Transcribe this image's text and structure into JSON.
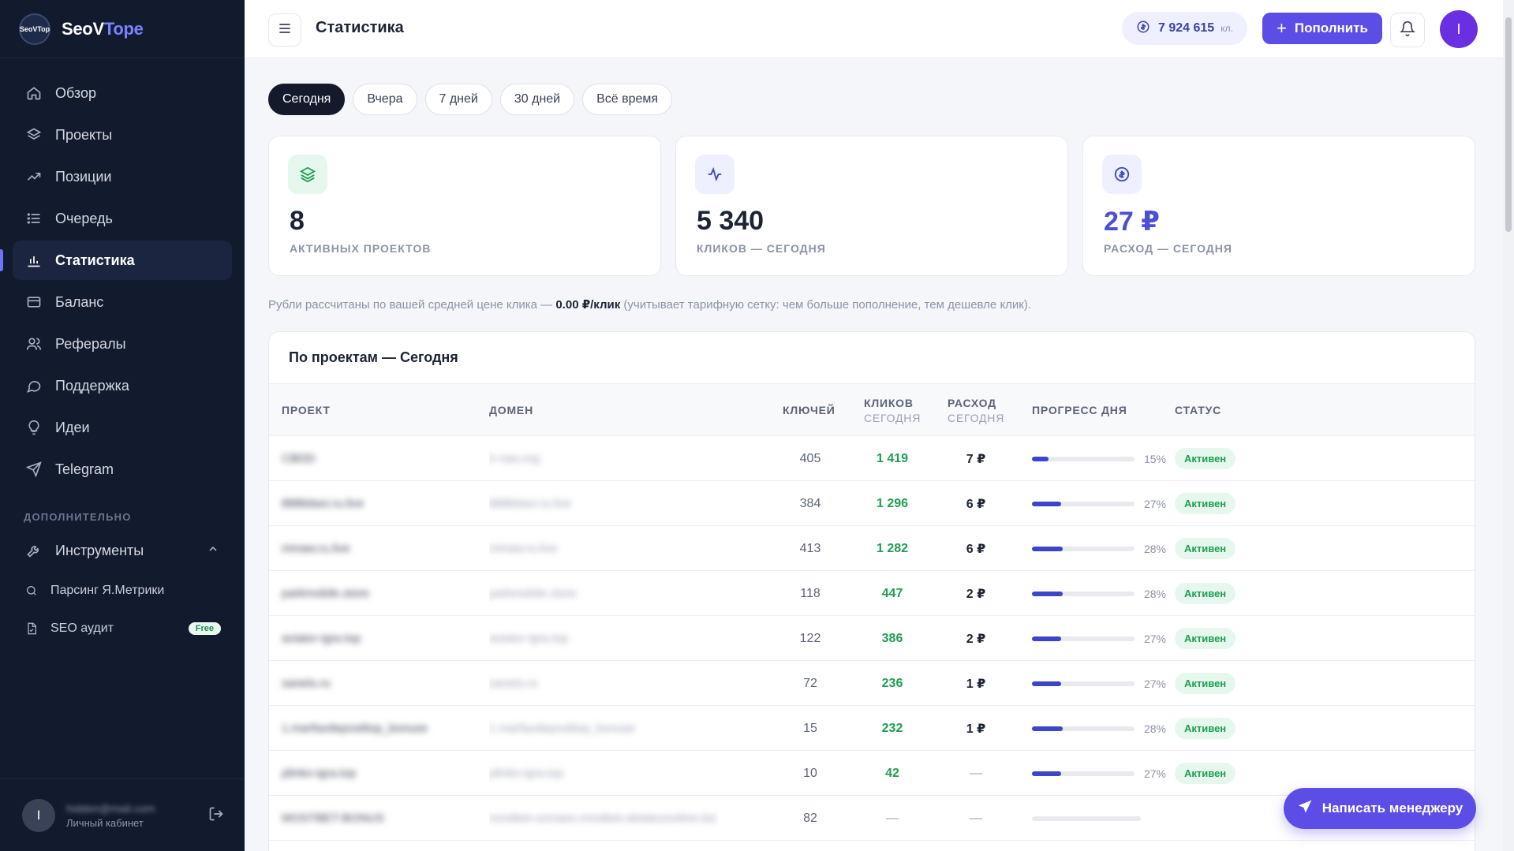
{
  "brand": {
    "logo_text": "SeoVTop",
    "name_main": "SeoV",
    "name_accent": "Tope"
  },
  "sidebar": {
    "items": [
      {
        "label": "Обзор",
        "icon": "home-icon"
      },
      {
        "label": "Проекты",
        "icon": "layers-icon"
      },
      {
        "label": "Позиции",
        "icon": "trend-icon"
      },
      {
        "label": "Очередь",
        "icon": "list-icon"
      },
      {
        "label": "Статистика",
        "icon": "bar-chart-icon",
        "active": true
      },
      {
        "label": "Баланс",
        "icon": "wallet-icon"
      },
      {
        "label": "Рефералы",
        "icon": "users-icon"
      },
      {
        "label": "Поддержка",
        "icon": "chat-icon"
      },
      {
        "label": "Идеи",
        "icon": "bulb-icon"
      },
      {
        "label": "Telegram",
        "icon": "send-icon"
      }
    ],
    "section_label": "ДОПОЛНИТЕЛЬНО",
    "tools_label": "Инструменты",
    "sub_items": [
      {
        "label": "Парсинг Я.Метрики",
        "icon": "search-icon"
      },
      {
        "label": "SEO аудит",
        "icon": "file-icon",
        "badge": "Free"
      }
    ],
    "user": {
      "avatar": "I",
      "email": "hidden@mail.com",
      "subtitle": "Личный кабинет"
    }
  },
  "topbar": {
    "title": "Статистика",
    "balance_value": "7 924 615",
    "balance_unit": "кл.",
    "topup_label": "Пополнить",
    "avatar": "I"
  },
  "periods": [
    "Сегодня",
    "Вчера",
    "7 дней",
    "30 дней",
    "Всё время"
  ],
  "stats": [
    {
      "value": "8",
      "label": "АКТИВНЫХ ПРОЕКТОВ",
      "color": "#1c2434",
      "icon_bg": "#e6f8ee",
      "icon_color": "#1e9e52"
    },
    {
      "value": "5 340",
      "label": "КЛИКОВ — СЕГОДНЯ",
      "color": "#1c2434",
      "icon_bg": "#eef0ff",
      "icon_color": "#3d45c9"
    },
    {
      "value": "27 ₽",
      "label": "РАСХОД — СЕГОДНЯ",
      "color": "#4a4fd6",
      "icon_bg": "#eef0ff",
      "icon_color": "#3d45c9"
    }
  ],
  "note": {
    "before": "Рубли рассчитаны по вашей средней цене клика — ",
    "bold": "0.00 ₽/клик",
    "after": " (учитывает тарифную сетку: чем больше пополнение, тем дешевле клик)."
  },
  "table": {
    "title": "По проектам — Сегодня",
    "headers": {
      "project": "ПРОЕКТ",
      "domain": "ДОМЕН",
      "keys": "КЛЮЧЕЙ",
      "clicks": "КЛИКОВ",
      "clicks_sub": "СЕГОДНЯ",
      "cost": "РАСХОД",
      "cost_sub": "СЕГОДНЯ",
      "progress": "ПРОГРЕСС ДНЯ",
      "status": "СТАТУС"
    },
    "rows": [
      {
        "project": "CBDD",
        "domain": "ir-nao.org",
        "keys": "405",
        "clicks": "1 419",
        "cost": "7 ₽",
        "progress": 15,
        "progress_label": "15%",
        "status": "Активен"
      },
      {
        "project": "888bitaxi.ru.live",
        "domain": "888bitaxi.ru.live",
        "keys": "384",
        "clicks": "1 296",
        "cost": "6 ₽",
        "progress": 27,
        "progress_label": "27%",
        "status": "Активен"
      },
      {
        "project": "minaw.ru.live",
        "domain": "minaw.ru.live",
        "keys": "413",
        "clicks": "1 282",
        "cost": "6 ₽",
        "progress": 28,
        "progress_label": "28%",
        "status": "Активен"
      },
      {
        "project": "parkmobile.store",
        "domain": "parkmobile.store",
        "keys": "118",
        "clicks": "447",
        "cost": "2 ₽",
        "progress": 28,
        "progress_label": "28%",
        "status": "Активен"
      },
      {
        "project": "aviator-igra.top",
        "domain": "aviator-igra.top",
        "keys": "122",
        "clicks": "386",
        "cost": "2 ₽",
        "progress": 27,
        "progress_label": "27%",
        "status": "Активен"
      },
      {
        "project": "sanets.ru",
        "domain": "sanets.ru",
        "keys": "72",
        "clicks": "236",
        "cost": "1 ₽",
        "progress": 27,
        "progress_label": "27%",
        "status": "Активен"
      },
      {
        "project": "1.marfaxdeposittop_bonuse",
        "domain": "1.marfaxdeposittop_bonuse",
        "keys": "15",
        "clicks": "232",
        "cost": "1 ₽",
        "progress": 28,
        "progress_label": "28%",
        "status": "Активен"
      },
      {
        "project": "plinko-igra.top",
        "domain": "plinko-igra.top",
        "keys": "10",
        "clicks": "42",
        "cost": "—",
        "progress": 27,
        "progress_label": "27%",
        "status": "Активен"
      },
      {
        "project": "MOSTBET-BONUS",
        "domain": "mostbet-oxmaes.mostbet-alstatusonline.biz",
        "keys": "82",
        "clicks": "—",
        "cost": "—",
        "progress": 0,
        "progress_label": "",
        "status": ""
      }
    ]
  },
  "manager_button": "Написать менеджеру"
}
